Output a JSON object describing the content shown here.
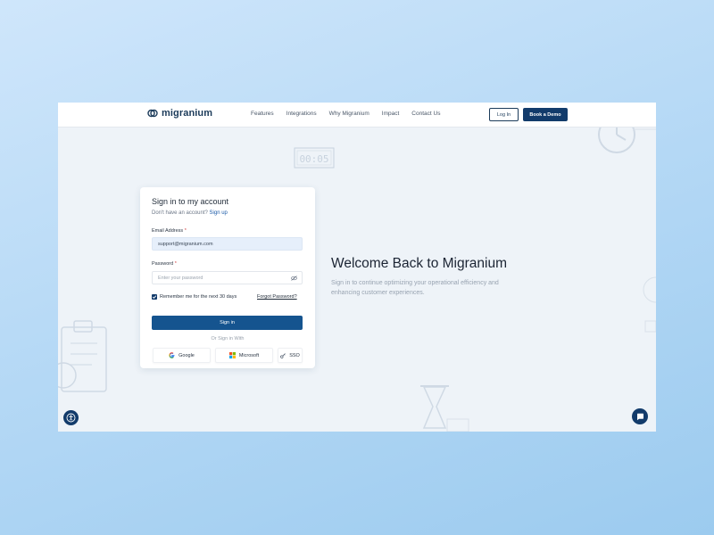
{
  "brand": {
    "name": "migranium",
    "color": "#123b6b"
  },
  "nav": {
    "links": [
      "Features",
      "Integrations",
      "Why Migranium",
      "Impact",
      "Contact Us"
    ],
    "login_label": "Log In",
    "demo_label": "Book a Demo"
  },
  "decor": {
    "timer_text": "00:05"
  },
  "signin": {
    "title": "Sign in to my account",
    "no_account_text": "Don't have an account?",
    "signup_link": "Sign up",
    "email_label": "Email Address",
    "email_value": "support@migranium.com",
    "password_label": "Password",
    "password_placeholder": "Enter your password",
    "required_mark": "*",
    "remember_label": "Remember me for the next 30 days",
    "forgot_label": "Forgot Password?",
    "signin_button": "Sign in",
    "or_text": "Or Sign in With",
    "google_label": "Google",
    "microsoft_label": "Microsoft",
    "sso_label": "SSO"
  },
  "welcome": {
    "title": "Welcome Back to Migranium",
    "subtitle": "Sign in to continue optimizing your operational efficiency and enhancing customer experiences."
  },
  "icons": {
    "logo": "migranium-logo-icon",
    "eye_off": "eye-off-icon",
    "accessibility": "accessibility-icon",
    "chat": "chat-icon",
    "google": "google-icon",
    "microsoft": "microsoft-icon",
    "sso": "key-icon"
  }
}
